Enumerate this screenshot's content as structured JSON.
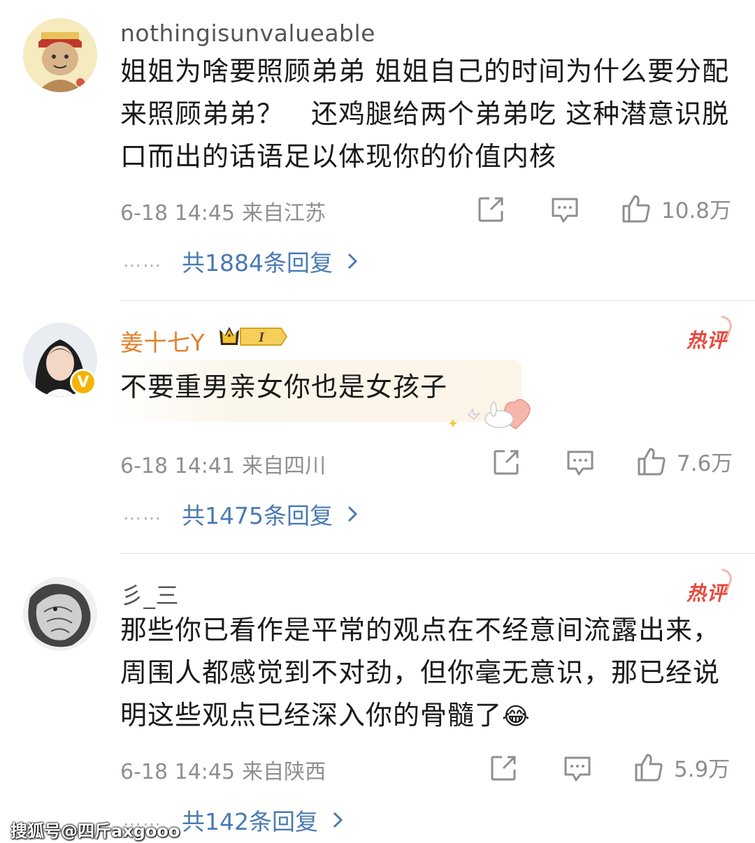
{
  "comments": [
    {
      "username": "nothingisunvalueable",
      "text": "姐姐为啥要照顾弟弟 姐姐自己的时间为什么要分配来照顾弟弟？　还鸡腿给两个弟弟吃 这种潜意识脱口而出的话语足以体现你的价值内核",
      "time": "6-18 14:45",
      "location": "来自江苏",
      "likes": "10.8万",
      "replies_label": "共1884条回复",
      "hot": false
    },
    {
      "username": "姜十七Y",
      "vip_level": "I",
      "text": "不要重男亲女你也是女孩子",
      "time": "6-18 14:41",
      "location": "来自四川",
      "likes": "7.6万",
      "replies_label": "共1475条回复",
      "hot": true,
      "hot_label": "热评"
    },
    {
      "username": "彡_三",
      "text": "那些你已看作是平常的观点在不经意间流露出来，周围人都感觉到不对劲，但你毫无意识，那已经说明这些观点已经深入你的骨髓了",
      "emoji": "😂",
      "time": "6-18 14:45",
      "location": "来自陕西",
      "likes": "5.9万",
      "replies_label": "共142条回复",
      "hot": true,
      "hot_label": "热评"
    }
  ],
  "dots": "……",
  "watermark": "搜狐号@四斤axgooo",
  "icons": [
    "share-icon",
    "comment-icon",
    "like-icon",
    "chevron-right-icon",
    "verified-v-icon",
    "crown-icon"
  ],
  "colors": {
    "link": "#4a7ab2",
    "vip_name": "#e2812b",
    "hot": "#e8483b",
    "meta": "#8f8f8f"
  }
}
